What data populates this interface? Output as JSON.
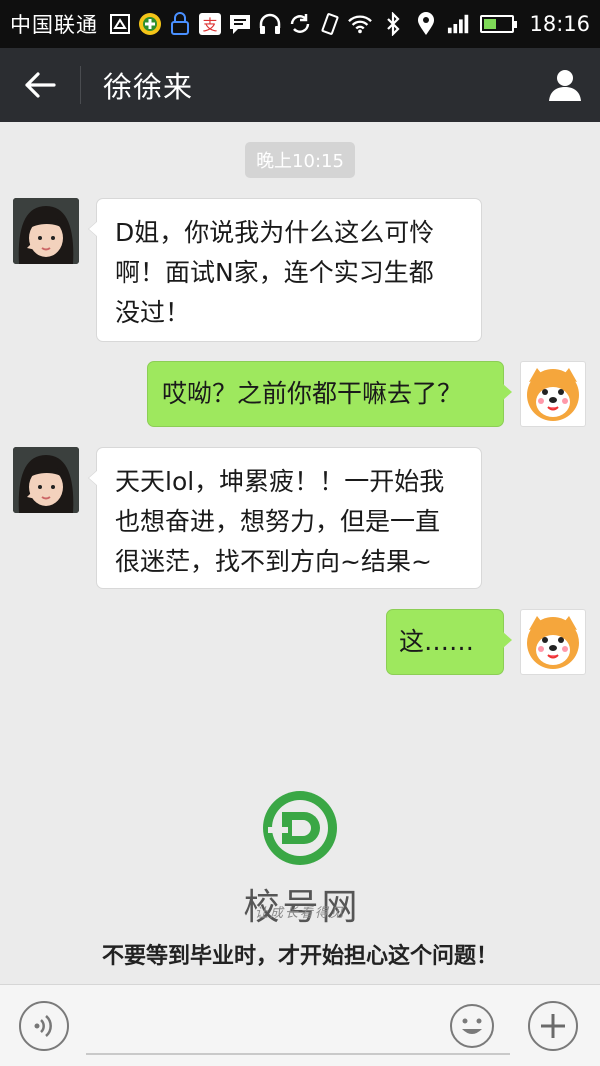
{
  "status_bar": {
    "carrier": "中国联通",
    "time": "18:16",
    "icons": [
      "sim-icon",
      "app-icon",
      "lock-app-icon",
      "alipay-icon",
      "message-icon",
      "headset-icon",
      "sync-icon",
      "vibrate-icon",
      "wifi-icon",
      "bluetooth-icon",
      "location-icon",
      "signal-icon",
      "battery-icon"
    ],
    "battery_level": 0.45
  },
  "nav": {
    "title": "徐徐来",
    "back_icon": "back-arrow-icon",
    "profile_icon": "person-icon",
    "bg_color": "#2b2d31"
  },
  "chat": {
    "timestamp": "晚上10:15",
    "messages": [
      {
        "side": "left",
        "lines": [
          "D姐，你说我为什么这么可怜",
          "啊！面试N家，连个实习生都",
          "没过！"
        ]
      },
      {
        "side": "right",
        "lines": [
          "哎呦？之前你都干嘛去了？"
        ]
      },
      {
        "side": "left",
        "lines": [
          "天天lol，坤累疲！！一开始我",
          "也想奋进，想努力，但是一直",
          "很迷茫，找不到方向~结果~"
        ]
      },
      {
        "side": "right",
        "lines": [
          "这……"
        ]
      }
    ],
    "bubble_colors": {
      "incoming": "#ffffff",
      "outgoing": "#9ee85e"
    }
  },
  "watermark": {
    "brand": "校号网",
    "slogan": "让成长看得见",
    "caption": "不要等到毕业时，才开始担心这个问题！",
    "logo_color": "#3aa745"
  },
  "input_bar": {
    "voice_icon": "voice-icon",
    "emoji_icon": "emoji-icon",
    "plus_icon": "plus-icon",
    "placeholder": ""
  }
}
